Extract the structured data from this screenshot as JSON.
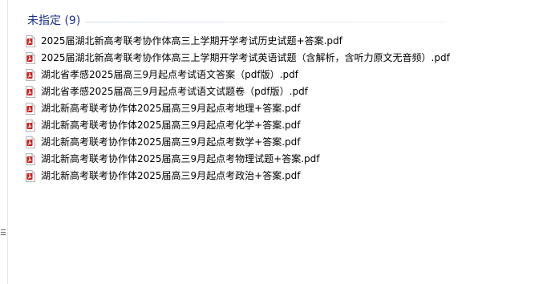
{
  "group": {
    "title": "未指定 (9)"
  },
  "files": [
    {
      "name": "2025届湖北新高考联考协作体高三上学期开学考试历史试题+答案.pdf",
      "icon": "pdf-file-icon"
    },
    {
      "name": "2025届湖北新高考联考协作体高三上学期开学考试英语试题（含解析，含听力原文无音频）.pdf",
      "icon": "pdf-file-icon"
    },
    {
      "name": "湖北省孝感2025届高三9月起点考试语文答案（pdf版）.pdf",
      "icon": "pdf-file-icon"
    },
    {
      "name": "湖北省孝感2025届高三9月起点考试语文试题卷（pdf版）.pdf",
      "icon": "pdf-file-icon"
    },
    {
      "name": "湖北新高考联考协作体2025届高三9月起点考地理+答案.pdf",
      "icon": "pdf-file-icon"
    },
    {
      "name": "湖北新高考联考协作体2025届高三9月起点考化学+答案.pdf",
      "icon": "pdf-file-icon"
    },
    {
      "name": "湖北新高考联考协作体2025届高三9月起点考数学+答案.pdf",
      "icon": "pdf-file-icon"
    },
    {
      "name": "湖北新高考联考协作体2025届高三9月起点考物理试题+答案.pdf",
      "icon": "pdf-file-icon"
    },
    {
      "name": "湖北新高考联考协作体2025届高三9月起点考政治+答案.pdf",
      "icon": "pdf-file-icon"
    }
  ],
  "colors": {
    "group_title": "#1e3287",
    "pdf_icon_red": "#c8201d",
    "text": "#000000"
  }
}
